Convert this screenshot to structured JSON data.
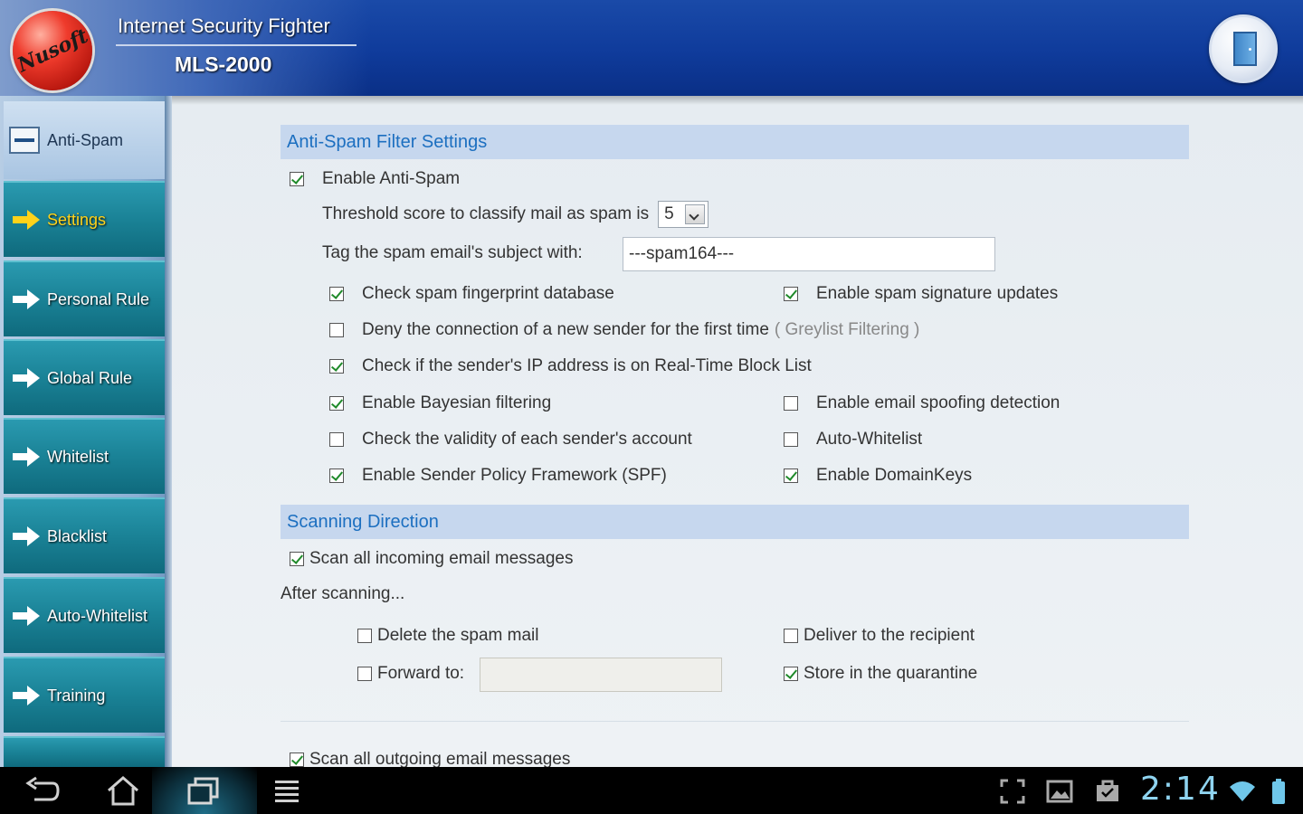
{
  "header": {
    "logo_text": "Nusoft",
    "title": "Internet Security Fighter",
    "model": "MLS-2000",
    "exit_icon": "door-exit-icon"
  },
  "sidebar": {
    "section_label": "Anti-Spam",
    "items": [
      {
        "label": "Settings",
        "active": true
      },
      {
        "label": "Personal Rule",
        "active": false
      },
      {
        "label": "Global Rule",
        "active": false
      },
      {
        "label": "Whitelist",
        "active": false
      },
      {
        "label": "Blacklist",
        "active": false
      },
      {
        "label": "Auto-Whitelist",
        "active": false
      },
      {
        "label": "Training",
        "active": false
      }
    ]
  },
  "filter_settings": {
    "section_title": "Anti-Spam Filter Settings",
    "enable_antispam": {
      "label": "Enable Anti-Spam",
      "checked": true
    },
    "threshold": {
      "label": "Threshold score to classify mail as spam is",
      "value": "5"
    },
    "tag_subject": {
      "label": "Tag the spam email's subject with:",
      "value": "---spam164---"
    },
    "options": {
      "fingerprint": {
        "label": "Check spam fingerprint database",
        "checked": true
      },
      "signature_updates": {
        "label": "Enable spam signature updates",
        "checked": true
      },
      "greylist": {
        "label": "Deny the connection of a new sender for the first time",
        "note": "( Greylist Filtering )",
        "checked": false
      },
      "rbl": {
        "label": "Check if the sender's IP address is on Real-Time Block List",
        "checked": true
      },
      "bayesian": {
        "label": "Enable Bayesian filtering",
        "checked": true
      },
      "spoofing": {
        "label": "Enable email spoofing detection",
        "checked": false
      },
      "validity": {
        "label": "Check the validity of each sender's account",
        "checked": false
      },
      "auto_whitelist": {
        "label": "Auto-Whitelist",
        "checked": false
      },
      "spf": {
        "label": "Enable Sender Policy Framework (SPF)",
        "checked": true
      },
      "domainkeys": {
        "label": "Enable DomainKeys",
        "checked": true
      }
    }
  },
  "scanning": {
    "section_title": "Scanning Direction",
    "incoming": {
      "label": "Scan all incoming email messages",
      "checked": true
    },
    "after_label": "After scanning...",
    "delete": {
      "label": "Delete the spam mail",
      "checked": false
    },
    "deliver": {
      "label": "Deliver to the recipient",
      "checked": false
    },
    "forward": {
      "label": "Forward to:",
      "checked": false,
      "value": ""
    },
    "quarantine": {
      "label": "Store in the quarantine",
      "checked": true
    },
    "outgoing": {
      "label": "Scan all outgoing email messages",
      "checked": true
    }
  },
  "system_bar": {
    "time": "2:14",
    "icons": [
      "back-icon",
      "home-icon",
      "recent-apps-icon",
      "menu-icon",
      "screenshot-icon",
      "gallery-icon",
      "store-icon",
      "wifi-icon",
      "battery-icon"
    ]
  }
}
